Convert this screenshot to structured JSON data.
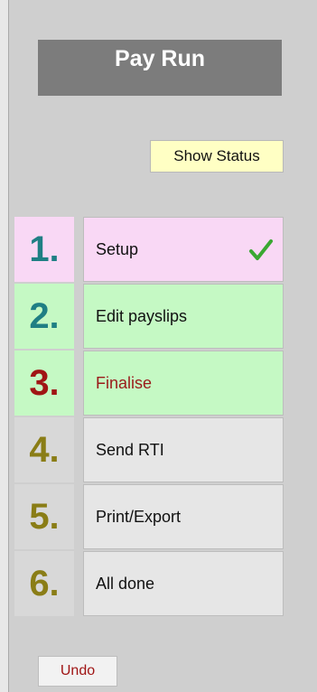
{
  "panel": {
    "title": "Pay Run"
  },
  "toolbar": {
    "show_status_label": "Show Status"
  },
  "steps": [
    {
      "number": "1.",
      "label": "Setup",
      "num_color": "#1f7f84",
      "num_bg": "#f9d8f5",
      "label_bg": "#f9d8f5",
      "label_color": "#111111",
      "completed": true
    },
    {
      "number": "2.",
      "label": "Edit payslips",
      "num_color": "#1f7f84",
      "num_bg": "#c5f9c4",
      "label_bg": "#c5f9c4",
      "label_color": "#111111",
      "completed": false
    },
    {
      "number": "3.",
      "label": "Finalise",
      "num_color": "#a01515",
      "num_bg": "#c5f9c4",
      "label_bg": "#c5f9c4",
      "label_color": "#9a1a1a",
      "completed": false
    },
    {
      "number": "4.",
      "label": "Send RTI",
      "num_color": "#8a7d16",
      "num_bg": "#d8d8d8",
      "label_bg": "#e6e6e6",
      "label_color": "#111111",
      "completed": false
    },
    {
      "number": "5.",
      "label": "Print/Export",
      "num_color": "#8a7d16",
      "num_bg": "#d8d8d8",
      "label_bg": "#e6e6e6",
      "label_color": "#111111",
      "completed": false
    },
    {
      "number": "6.",
      "label": "All done",
      "num_color": "#8a7d16",
      "num_bg": "#d8d8d8",
      "label_bg": "#e6e6e6",
      "label_color": "#111111",
      "completed": false
    }
  ],
  "footer": {
    "undo_label": "Undo"
  },
  "icons": {
    "complete": "checkmark-icon"
  },
  "colors": {
    "check": "#3aa832",
    "title_bg": "#7c7c7c",
    "status_bg": "#ffffc4"
  }
}
